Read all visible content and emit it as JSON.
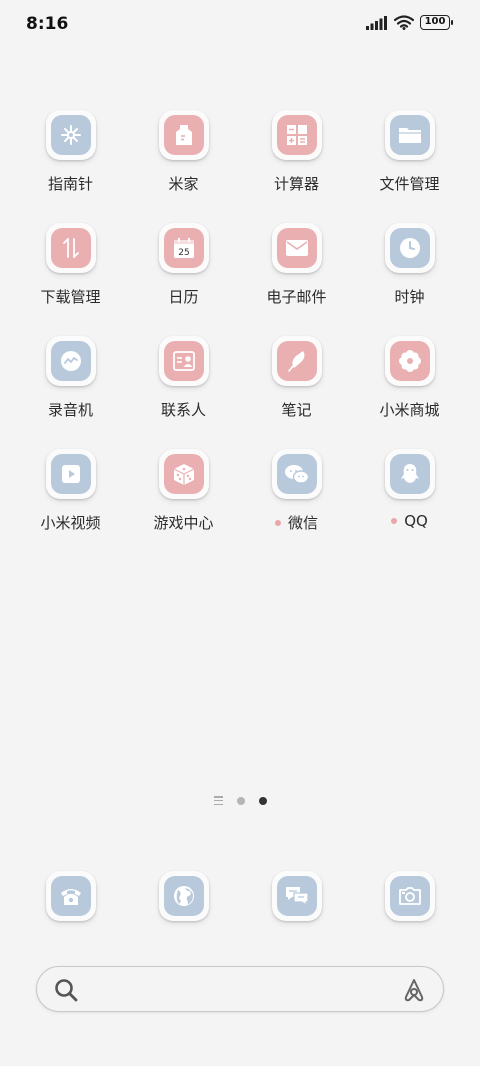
{
  "status": {
    "time": "8:16",
    "battery": "100"
  },
  "apps": [
    {
      "label": "指南针",
      "icon": "compass-icon",
      "color": "blue"
    },
    {
      "label": "米家",
      "icon": "mijia-icon",
      "color": "pink"
    },
    {
      "label": "计算器",
      "icon": "calculator-icon",
      "color": "pink"
    },
    {
      "label": "文件管理",
      "icon": "folder-icon",
      "color": "blue"
    },
    {
      "label": "下载管理",
      "icon": "download-icon",
      "color": "pink"
    },
    {
      "label": "日历",
      "icon": "calendar-icon",
      "color": "pink",
      "badge": "25"
    },
    {
      "label": "电子邮件",
      "icon": "mail-icon",
      "color": "pink"
    },
    {
      "label": "时钟",
      "icon": "clock-icon",
      "color": "blue"
    },
    {
      "label": "录音机",
      "icon": "recorder-icon",
      "color": "blue"
    },
    {
      "label": "联系人",
      "icon": "contacts-icon",
      "color": "pink"
    },
    {
      "label": "笔记",
      "icon": "notes-icon",
      "color": "pink"
    },
    {
      "label": "小米商城",
      "icon": "mi-store-icon",
      "color": "pink"
    },
    {
      "label": "小米视频",
      "icon": "video-icon",
      "color": "blue"
    },
    {
      "label": "游戏中心",
      "icon": "dice-icon",
      "color": "pink"
    },
    {
      "label": "微信",
      "icon": "wechat-icon",
      "color": "blue",
      "notify": true
    },
    {
      "label": "QQ",
      "icon": "qq-icon",
      "color": "blue",
      "notify": true
    }
  ],
  "dock": [
    {
      "icon": "phone-icon",
      "color": "blue"
    },
    {
      "icon": "browser-icon",
      "color": "blue"
    },
    {
      "icon": "messages-icon",
      "color": "blue"
    },
    {
      "icon": "camera-icon",
      "color": "blue"
    }
  ],
  "colors": {
    "blue_tile": "#b7c9db",
    "pink_tile": "#eab0b1",
    "notify_dot": "#eaa6a8"
  }
}
